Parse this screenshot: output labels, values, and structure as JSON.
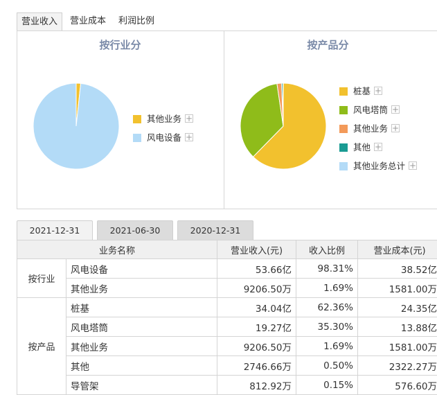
{
  "tabs": [
    {
      "label": "营业收入",
      "active": true
    },
    {
      "label": "营业成本",
      "active": false
    },
    {
      "label": "利润比例",
      "active": false
    }
  ],
  "chart_data": [
    {
      "type": "pie",
      "title": "按行业分",
      "categories": [
        "其他业务",
        "风电设备"
      ],
      "values": [
        1.69,
        98.31
      ],
      "colors": [
        "#f2c12e",
        "#b3dbf7"
      ]
    },
    {
      "type": "pie",
      "title": "按产品分",
      "categories": [
        "桩基",
        "风电塔筒",
        "其他业务",
        "其他",
        "其他业务总计"
      ],
      "values": [
        62.36,
        35.3,
        1.69,
        0.5,
        0.15
      ],
      "colors": [
        "#f2c12e",
        "#8fbc1a",
        "#f39a5a",
        "#1a9b93",
        "#b3dbf7"
      ]
    }
  ],
  "date_tabs": [
    {
      "label": "2021-12-31",
      "active": true
    },
    {
      "label": "2021-06-30",
      "active": false
    },
    {
      "label": "2020-12-31",
      "active": false
    }
  ],
  "table": {
    "headers": [
      "业务名称",
      "营业收入(元)",
      "收入比例",
      "营业成本(元)"
    ],
    "groups": [
      {
        "label": "按行业",
        "rows": [
          [
            "风电设备",
            "53.66亿",
            "98.31%",
            "38.52亿"
          ],
          [
            "其他业务",
            "9206.50万",
            "1.69%",
            "1581.00万"
          ]
        ]
      },
      {
        "label": "按产品",
        "rows": [
          [
            "桩基",
            "34.04亿",
            "62.36%",
            "24.35亿"
          ],
          [
            "风电塔筒",
            "19.27亿",
            "35.30%",
            "13.88亿"
          ],
          [
            "其他业务",
            "9206.50万",
            "1.69%",
            "1581.00万"
          ],
          [
            "其他",
            "2746.66万",
            "0.50%",
            "2322.27万"
          ],
          [
            "导管架",
            "812.92万",
            "0.15%",
            "576.60万"
          ]
        ]
      }
    ]
  },
  "plus_symbol": "+"
}
